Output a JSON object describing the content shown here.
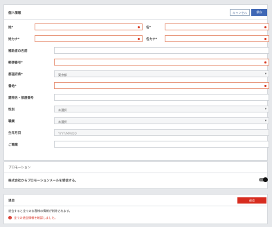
{
  "personal": {
    "title": "個人情報",
    "cancel_label": "キャンセル",
    "save_label": "保存",
    "fields": {
      "last_name": "姓*",
      "first_name": "名*",
      "last_kana": "姓カナ*",
      "first_kana": "名カナ*",
      "company_name": "補助者の名前",
      "postal_code": "郵便番号*",
      "prefecture": "都道府県*",
      "address": "番地*",
      "building_room": "建物名・部屋番号",
      "gender": "性別",
      "occupation": "職業",
      "birthday": "生年月日",
      "remarks": "ご職業"
    },
    "values": {
      "prefecture": "東京都",
      "gender": "未選択",
      "occupation": "未選択",
      "birthday_placeholder": "YYYY/MM/DD"
    }
  },
  "promotion": {
    "title": "プロモーション",
    "text": "株式会社からプロモーションメールを受信する。",
    "toggle_on": true
  },
  "delete": {
    "title": "退会",
    "button_label": "退会",
    "note": "退会すると全てのお客様の情報が削除されます。",
    "warning": "全ての退会情報を確認しました。"
  },
  "colors": {
    "primary": "#3f67b5",
    "danger": "#d72c1f",
    "required_border": "#e8977c"
  }
}
